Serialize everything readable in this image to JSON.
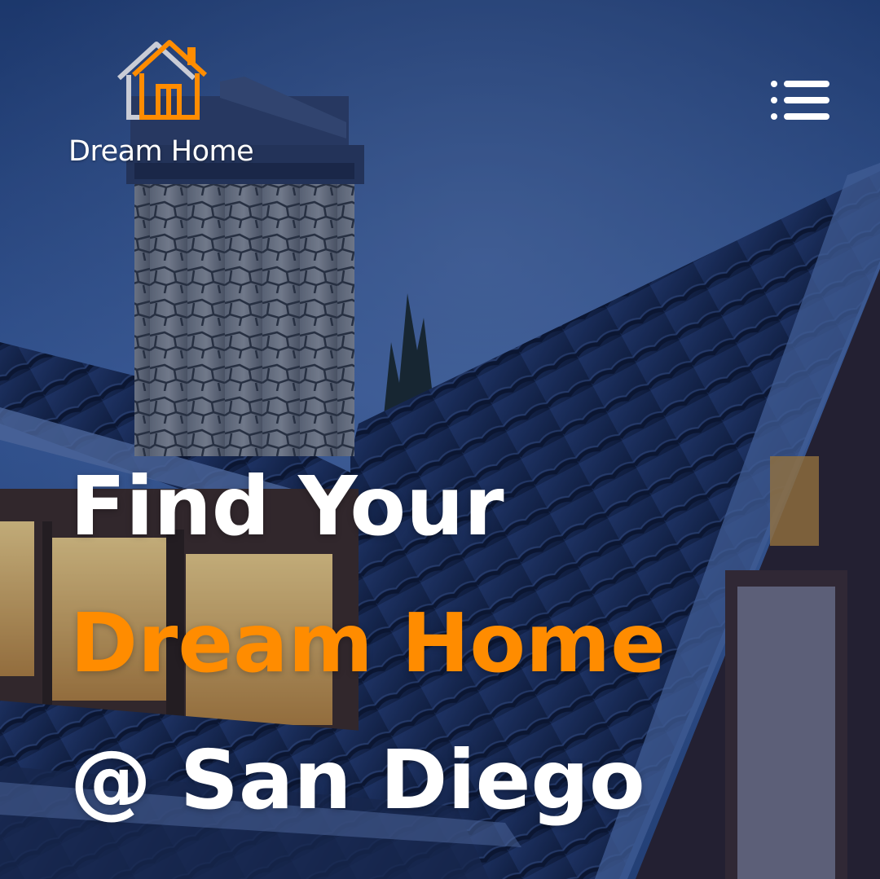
{
  "brand": {
    "name": "Dream Home",
    "logo_icon": "house-outline-icon",
    "accent_color": "#ff8c00"
  },
  "header": {
    "menu_icon": "hamburger-menu-icon"
  },
  "hero": {
    "line1": "Find Your",
    "line2": "Dream Home",
    "line3": "@ San Diego",
    "text_color": "#ffffff",
    "highlight_color": "#ff8c00",
    "background": "house-roof-chimney-dusk-photo"
  }
}
